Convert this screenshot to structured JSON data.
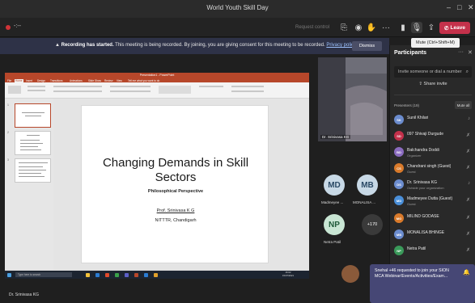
{
  "window": {
    "title": "World Youth Skill Day",
    "controls": [
      "–",
      "□",
      "✕"
    ]
  },
  "toolbar": {
    "timer": "-:--",
    "request_control": "Request control",
    "leave_label": "Leave",
    "buttons": [
      {
        "name": "share-tray-icon",
        "glyph": "⎘"
      },
      {
        "name": "camera-icon",
        "glyph": "◉"
      },
      {
        "name": "raise-hand-icon",
        "glyph": "✋"
      },
      {
        "name": "more-options-icon",
        "glyph": "···"
      },
      {
        "name": "video-off-icon",
        "glyph": "▮"
      },
      {
        "name": "mic-icon",
        "glyph": "🎙"
      },
      {
        "name": "share-screen-icon",
        "glyph": "⇪"
      }
    ]
  },
  "tooltip": {
    "text": "Mute (Ctrl+Shift+M)"
  },
  "banner": {
    "bold": "Recording has started.",
    "text": " This meeting is being recorded. By joining, you are giving consent for this meeting to be recorded.",
    "link": "Privacy policy",
    "dismiss": "Dismiss"
  },
  "ppt": {
    "title": "Presentation1 - PowerPoint",
    "tabs": [
      "File",
      "Home",
      "Insert",
      "Design",
      "Transitions",
      "Animations",
      "Slide Show",
      "Review",
      "View",
      "Tell me what you want to do"
    ],
    "slide": {
      "title_line1": "Changing Demands in Skill",
      "title_line2": "Sectors",
      "subtitle": "Philosophical Perspective",
      "author": "Prof. Srinivasa K G",
      "institution": "NITTTR, Chandigarh"
    },
    "status": "Slide 1 of 11",
    "zoom": "54%"
  },
  "taskbar": {
    "search": "Type here to search",
    "time": "16:02",
    "date": "15/07/2021"
  },
  "shared_by": "Dr. Srinivasa KG",
  "stage": {
    "video_name": "Dr. Srinivasa KG",
    "tiles": [
      {
        "initials": "MD",
        "label": "Madmeyee ...",
        "bg": "#c8d9e6",
        "fg": "#2b4a66"
      },
      {
        "initials": "MB",
        "label": "MONALISA ...",
        "bg": "#c8d9e6",
        "fg": "#2b4a66"
      },
      {
        "initials": "NP",
        "label": "Netra Patil",
        "bg": "#c9e6d4",
        "fg": "#1f5a3a"
      }
    ],
    "more": "+170"
  },
  "participants": {
    "title": "Participants",
    "invite_placeholder": "Invite someone or dial a number",
    "share_invite": "Share invite",
    "presenters_label": "Presenters (19)",
    "mute_all": "Mute all",
    "list": [
      {
        "name": "Sunil Khilari",
        "role": "",
        "initials": "SK",
        "color": "#6b8cce"
      },
      {
        "name": "097 Shivaji Durgude",
        "role": "",
        "initials": "SD",
        "color": "#c4314b"
      },
      {
        "name": "Balchandra Doddi",
        "role": "Organizer",
        "initials": "BD",
        "color": "#8a6bbf"
      },
      {
        "name": "Chandrani singh (Guest)",
        "role": "Guest",
        "initials": "CS",
        "color": "#d97a2b"
      },
      {
        "name": "Dr. Srinivasa KG",
        "role": "Outside your organization",
        "initials": "DS",
        "color": "#6b8cce"
      },
      {
        "name": "Madmeyee Dutta (Guest)",
        "role": "Guest",
        "initials": "MD",
        "color": "#4a8fd9"
      },
      {
        "name": "MILIND GODASE",
        "role": "",
        "initials": "MG",
        "color": "#d97a2b"
      },
      {
        "name": "MONALISA BHINGE",
        "role": "",
        "initials": "MB",
        "color": "#6b8cce"
      },
      {
        "name": "Netra Patil",
        "role": "",
        "initials": "NP",
        "color": "#3a9a5a"
      }
    ]
  },
  "notification": {
    "text": "Snehal +46 requested to join your SION MCA Webinar/Events/Activities/Exam..."
  }
}
